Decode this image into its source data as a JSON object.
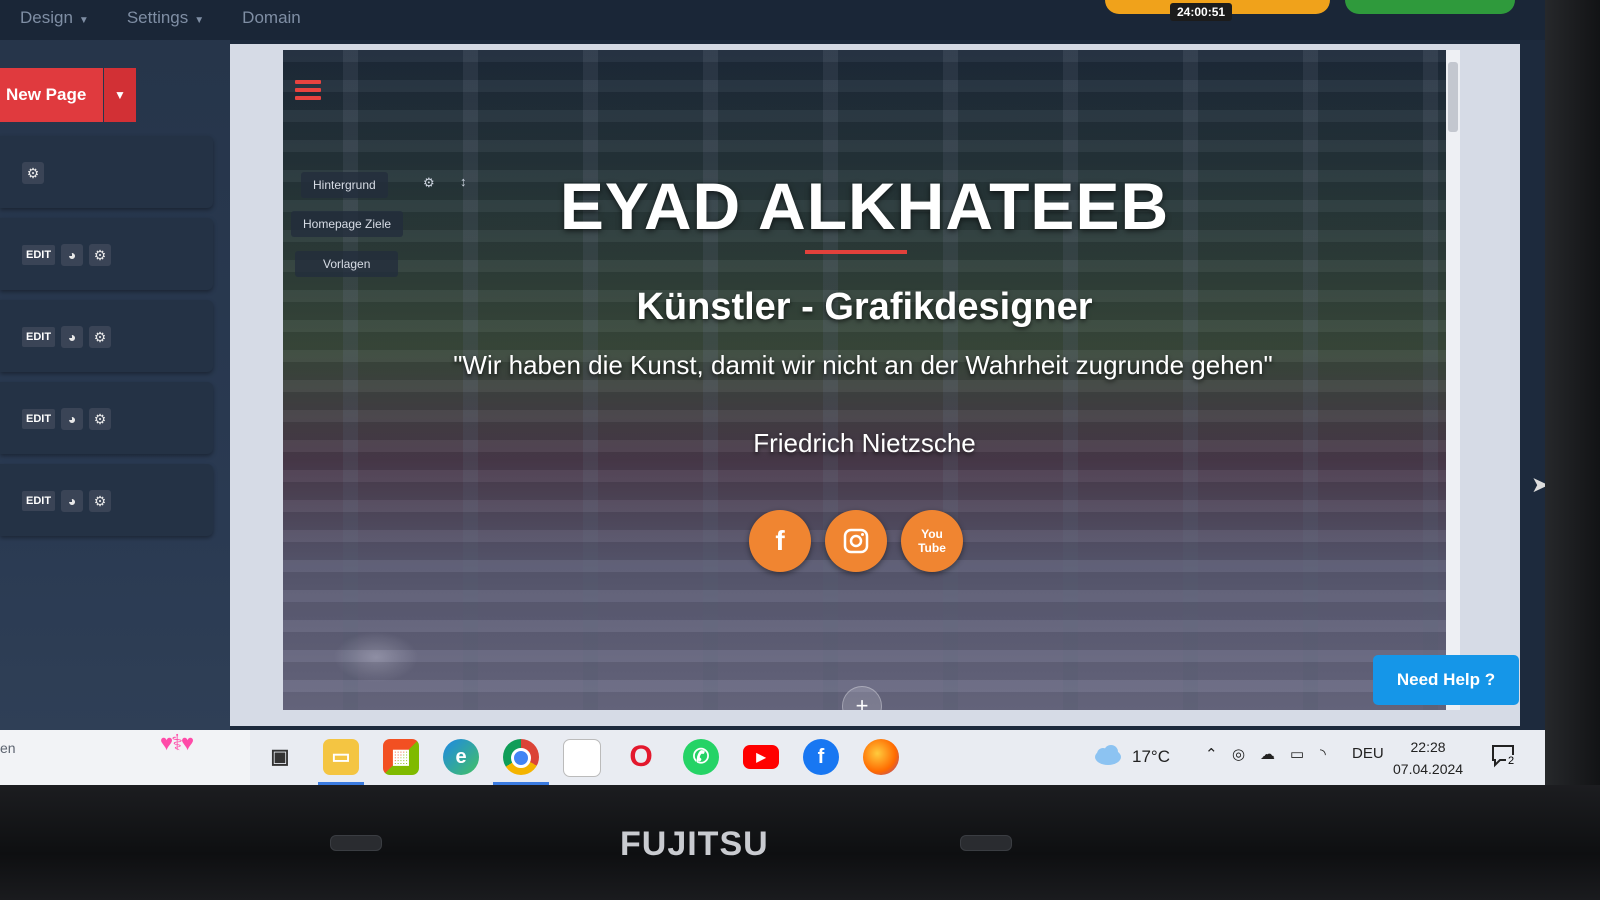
{
  "topbar": {
    "nav": [
      {
        "label": "Design",
        "has_caret": true
      },
      {
        "label": "Settings",
        "has_caret": true
      },
      {
        "label": "Domain",
        "has_caret": false
      }
    ],
    "timer": "24:00:51"
  },
  "sidebar": {
    "new_page_label": "New Page",
    "sections": [
      {
        "edit_label": ""
      },
      {
        "edit_label": "EDIT"
      },
      {
        "edit_label": "EDIT"
      },
      {
        "edit_label": "EDIT"
      },
      {
        "edit_label": "EDIT"
      }
    ],
    "search_hint": "en"
  },
  "preview": {
    "tools": {
      "background_label": "Hintergrund",
      "goals_label": "Homepage Ziele",
      "templates_label": "Vorlagen"
    },
    "hero": {
      "title": "EYAD ALKHATEEB",
      "subtitle": "Künstler - Grafikdesigner",
      "quote": "\"Wir haben die Kunst, damit wir nicht an der Wahrheit zugrunde gehen\"",
      "author": "Friedrich Nietzsche"
    },
    "social": [
      "facebook-icon",
      "instagram-icon",
      "youtube-icon"
    ],
    "youtube_text": "You\nTube",
    "help_button": "Need Help ?"
  },
  "taskbar": {
    "apps": [
      "task-view-icon",
      "file-explorer-icon",
      "microsoft-store-icon",
      "edge-icon",
      "chrome-icon",
      "notepad-icon",
      "opera-icon",
      "whatsapp-icon",
      "youtube-icon",
      "facebook-icon",
      "firefox-icon"
    ],
    "active_app": "chrome-icon",
    "weather": "17°C",
    "language": "DEU",
    "time": "22:28",
    "date": "07.04.2024",
    "notification_count": "2"
  },
  "laptop": {
    "brand": "FUJITSU"
  },
  "colors": {
    "accent_red": "#e03a3e",
    "social_orange": "#f08531",
    "help_blue": "#1596e8"
  }
}
